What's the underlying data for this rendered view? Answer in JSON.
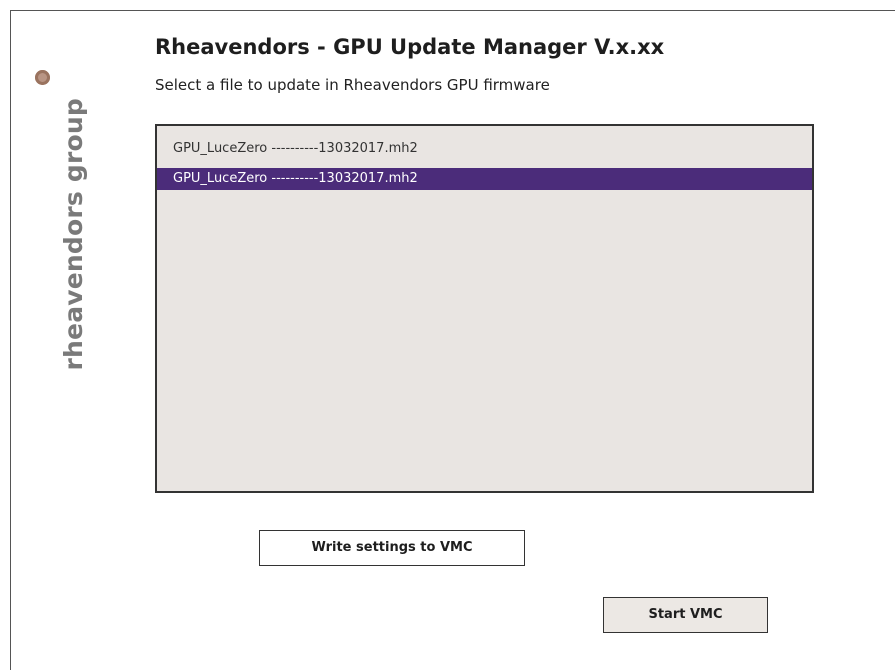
{
  "brand": {
    "name": "rheavendors group"
  },
  "header": {
    "title": "Rheavendors - GPU Update Manager V.x.xx",
    "subtitle": "Select a file to update in Rheavendors GPU firmware"
  },
  "file_list": {
    "items": [
      {
        "label": "GPU_LuceZero ----------13032017.mh2",
        "selected": false
      },
      {
        "label": "GPU_LuceZero ----------13032017.mh2",
        "selected": true
      }
    ]
  },
  "buttons": {
    "write_settings": "Write settings to VMC",
    "start_vmc": "Start VMC"
  },
  "colors": {
    "selection": "#4b2c7a",
    "list_background": "#e9e5e2",
    "brand_dot": "#b99584",
    "brand_text": "#7a7a7a"
  }
}
